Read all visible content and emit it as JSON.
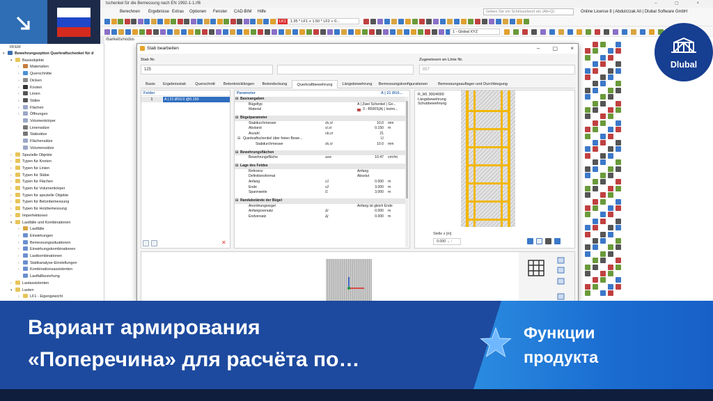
{
  "app": {
    "title": "tschenkel für die Bemessung nach EN 1992-1-1.rf6",
    "window_controls": [
      "–",
      "▢",
      "×"
    ],
    "menu": [
      "Berechnen",
      "Ergebnisse",
      "Extras",
      "Optionen",
      "Fenster",
      "CAD-BIM",
      "Hilfe"
    ],
    "search_placeholder": "Geben Sie ein Schlüsselwort ein (Alt+Q)",
    "license": "Online License 8 | Abdulrzzak Ali | Dlubal Software GmbH",
    "load_case_badge": "LK1",
    "load_combo": "1.35 * LF1 + 1.50 * LF2 + 0...",
    "view": "1 - Global XYZ",
    "status_label": "rbarkeitsmodus"
  },
  "navigator": {
    "header": "RFEM",
    "items": [
      {
        "label": "Bewehrungsoption Querkraftschenkel für d",
        "bold": true,
        "indent": 0,
        "exp": "▾",
        "color": "#3a6fb0"
      },
      {
        "label": "Basisobjekte",
        "indent": 1,
        "exp": "▾",
        "color": "#e8c45a"
      },
      {
        "label": "Materialien",
        "indent": 2,
        "exp": "›",
        "color": "#c77b3a"
      },
      {
        "label": "Querschnitte",
        "indent": 2,
        "exp": "›",
        "color": "#4a8fd6"
      },
      {
        "label": "Dicken",
        "indent": 2,
        "exp": "›",
        "color": "#8a8a8a"
      },
      {
        "label": "Knoten",
        "indent": 2,
        "exp": "›",
        "color": "#333333"
      },
      {
        "label": "Linien",
        "indent": 2,
        "exp": "›",
        "color": "#555555"
      },
      {
        "label": "Stäbe",
        "indent": 2,
        "exp": "›",
        "color": "#555555"
      },
      {
        "label": "Flächen",
        "indent": 2,
        "exp": "›",
        "color": "#9aa7c7"
      },
      {
        "label": "Öffnungen",
        "indent": 2,
        "exp": "›",
        "color": "#9aa7c7"
      },
      {
        "label": "Volumenkörper",
        "indent": 2,
        "exp": "",
        "color": "#9aa7c7"
      },
      {
        "label": "Liniensätze",
        "indent": 2,
        "exp": "",
        "color": "#777777"
      },
      {
        "label": "Stabsätze",
        "indent": 2,
        "exp": "",
        "color": "#777777"
      },
      {
        "label": "Flächensätze",
        "indent": 2,
        "exp": "",
        "color": "#9aa7c7"
      },
      {
        "label": "Volumensätze",
        "indent": 2,
        "exp": "",
        "color": "#9aa7c7"
      },
      {
        "label": "Spezielle Objekte",
        "indent": 1,
        "exp": "›",
        "color": "#e8c45a"
      },
      {
        "label": "Typen für Knoten",
        "indent": 1,
        "exp": "›",
        "color": "#e8c45a"
      },
      {
        "label": "Typen für Linien",
        "indent": 1,
        "exp": "›",
        "color": "#e8c45a"
      },
      {
        "label": "Typen für Stäbe",
        "indent": 1,
        "exp": "›",
        "color": "#e8c45a"
      },
      {
        "label": "Typen für Flächen",
        "indent": 1,
        "exp": "›",
        "color": "#e8c45a"
      },
      {
        "label": "Typen für Volumenkörper",
        "indent": 1,
        "exp": "›",
        "color": "#e8c45a"
      },
      {
        "label": "Typen für spezielle Objekte",
        "indent": 1,
        "exp": "›",
        "color": "#e8c45a"
      },
      {
        "label": "Typen für Betonbemessung",
        "indent": 1,
        "exp": "›",
        "color": "#e8c45a"
      },
      {
        "label": "Typen für Holzbemessung",
        "indent": 1,
        "exp": "›",
        "color": "#e8c45a"
      },
      {
        "label": "Imperfektionen",
        "indent": 1,
        "exp": "›",
        "color": "#e8c45a"
      },
      {
        "label": "Lastfälle und Kombinationen",
        "indent": 1,
        "exp": "▾",
        "color": "#e8c45a"
      },
      {
        "label": "Lastfälle",
        "indent": 2,
        "exp": "›",
        "color": "#d9a441"
      },
      {
        "label": "Einwirkungen",
        "indent": 2,
        "exp": "›",
        "color": "#6b8fd0"
      },
      {
        "label": "Bemessungssituationen",
        "indent": 2,
        "exp": "›",
        "color": "#6b8fd0"
      },
      {
        "label": "Einwirkungskombinationen",
        "indent": 2,
        "exp": "›",
        "color": "#6b8fd0"
      },
      {
        "label": "Lastkombinationen",
        "indent": 2,
        "exp": "›",
        "color": "#6b8fd0"
      },
      {
        "label": "Statikanalyse-Einstellungen",
        "indent": 2,
        "exp": "›",
        "color": "#6b8fd0"
      },
      {
        "label": "Kombinationsassistenten",
        "indent": 2,
        "exp": "›",
        "color": "#6b8fd0"
      },
      {
        "label": "Lastfallbeziehung",
        "indent": 2,
        "exp": "",
        "color": "#6b8fd0"
      },
      {
        "label": "Lastassistenten",
        "indent": 1,
        "exp": "›",
        "color": "#e8c45a"
      },
      {
        "label": "Lasten",
        "indent": 1,
        "exp": "▾",
        "color": "#e8c45a"
      },
      {
        "label": "LF1 - Eigengewicht",
        "indent": 2,
        "exp": "›",
        "color": "#e8c45a"
      }
    ]
  },
  "dialog": {
    "title": "Stab bearbeiten",
    "controls": [
      "–",
      "▢",
      "×"
    ],
    "stab_nr_label": "Stab Nr.",
    "stab_nr": "125",
    "zugewiesen_label": "Zugewiesen an Linie Nr.",
    "zugewiesen": "857",
    "tabs": [
      "Basis",
      "Ergebnisstab",
      "Querschnitt",
      "Betonknicklängen",
      "Betondeckung",
      "Querkraftbewehrung",
      "Längsbewehrung",
      "Bemessungskonfigurationen",
      "Bemessungsauflager und Durchbiegung"
    ],
    "active_tab": 5,
    "felder_label": "Felder",
    "felder_row_no": "1",
    "felder_row_val": "A | 21 Ø10.0 @0.150",
    "params_label": "Parameter",
    "params_ref": "A | 21 Ø10...",
    "rows": [
      {
        "type": "grp",
        "label": "Basisangaben"
      },
      {
        "label": "Bügeltyp",
        "val": "A | Zwei Schenkel | Ge...",
        "valLeft": true
      },
      {
        "label": "Material",
        "val": "3 - B500S(A) | Isotro...",
        "valLeft": true,
        "swatch": true
      },
      {
        "type": "gap"
      },
      {
        "type": "grp",
        "label": "Bügelparameter"
      },
      {
        "label": "Stabdurchmesser",
        "sym": "ds,st",
        "val": "10.0",
        "unit": "mm"
      },
      {
        "label": "Abstand",
        "sym": "sl,st",
        "val": "0.150",
        "unit": "m"
      },
      {
        "label": "Anzahl",
        "sym": "nb,st",
        "val": "21",
        "unit": ""
      },
      {
        "label": "Querkraftschenkel über freien Bewe...",
        "sym": "",
        "val": "☑",
        "unit": "",
        "exp": true
      },
      {
        "label": "Stabdurchmesser",
        "sym": "ds,st",
        "val": "10.0",
        "unit": "mm",
        "deep": true
      },
      {
        "type": "gap"
      },
      {
        "type": "grp",
        "label": "Bewehrungsflächen"
      },
      {
        "label": "Bewehrungsfläche",
        "sym": "asw",
        "val": "10.47",
        "unit": "cm²/m"
      },
      {
        "type": "gap"
      },
      {
        "type": "grp",
        "label": "Lage des Feldes"
      },
      {
        "label": "Referenz",
        "val": "Anfang",
        "valLeft": true
      },
      {
        "label": "Definitionsformat",
        "val": "Absolut",
        "valLeft": true
      },
      {
        "label": "Anfang",
        "sym": "x1",
        "val": "0.000",
        "unit": "m"
      },
      {
        "label": "Ende",
        "sym": "x2",
        "val": "3.000",
        "unit": "m"
      },
      {
        "label": "Spannweite",
        "sym": "l1",
        "val": "3.000",
        "unit": "m"
      },
      {
        "type": "gap"
      },
      {
        "type": "grp",
        "label": "Randabstände der Bügel"
      },
      {
        "label": "Anordnungsregel",
        "val": "Anfang ist gleich Ende",
        "valLeft": true
      },
      {
        "label": "Anfangsversatz",
        "sym": "Δi",
        "val": "0.000",
        "unit": "m"
      },
      {
        "label": "Endversatz",
        "sym": "Δj",
        "val": "0.000",
        "unit": "m"
      }
    ],
    "preview_lines": [
      "R_M1 300/4000",
      "Längsbewehrung",
      "Schubbewehrung"
    ],
    "stelle_label": "Stelle x [m]",
    "stelle_value": "0.000"
  },
  "brand": {
    "logo_text": "Dlubal",
    "headline": [
      "Вариант армирования",
      "«Поперечина» для расчёта по…"
    ],
    "feature": [
      "Функции",
      "продукта"
    ],
    "colors": {
      "banner": "#1d4a9e",
      "accent": "#2a8be0",
      "rebar": "#f2b705",
      "selection": "#2f6ebf"
    }
  }
}
